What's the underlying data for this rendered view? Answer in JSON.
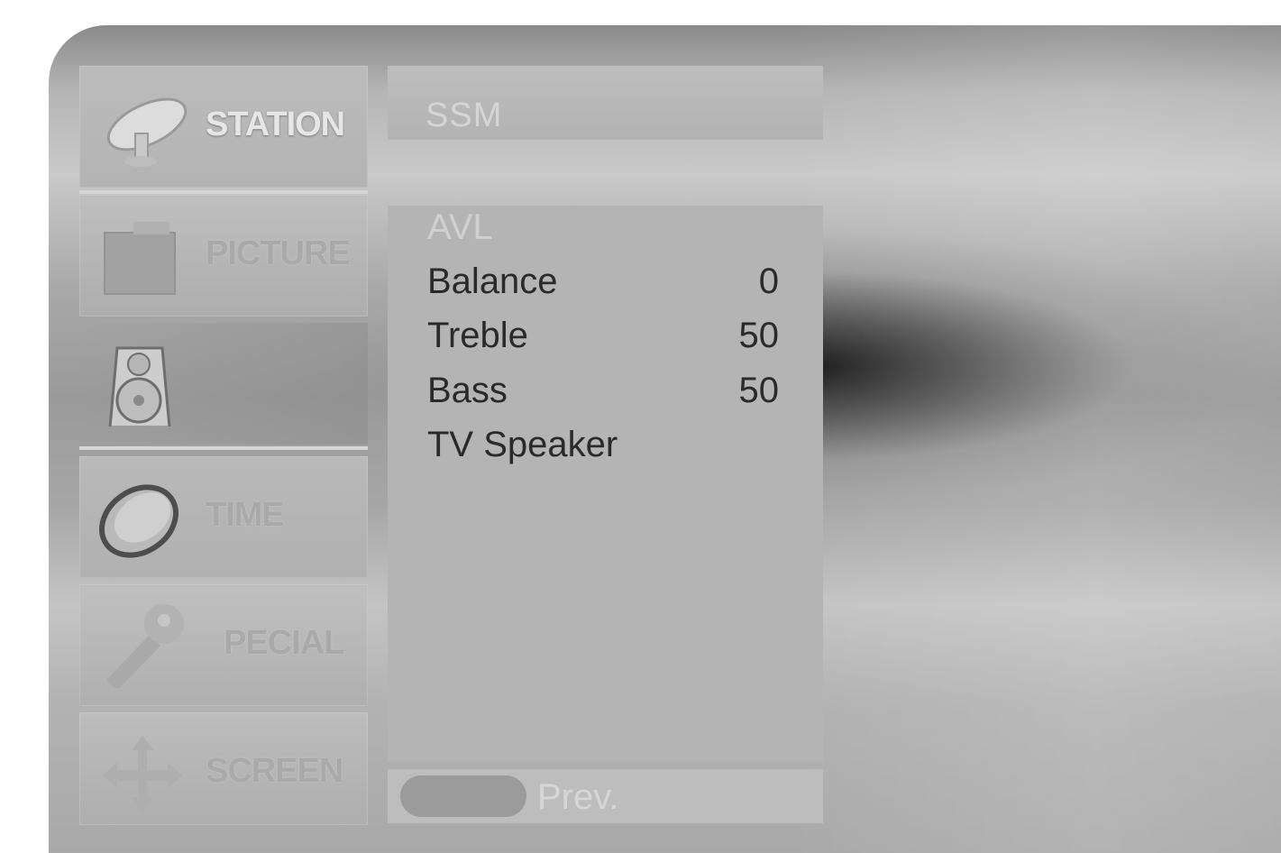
{
  "menu": {
    "categories": [
      {
        "label": "STATION",
        "icon": "satellite-dish-icon"
      },
      {
        "label": "PICTURE",
        "icon": "monitor-icon"
      },
      {
        "label": "",
        "icon": "speaker-icon"
      },
      {
        "label": "TIME",
        "icon": "clock-icon"
      },
      {
        "label": "PECIAL",
        "icon": "key-icon"
      },
      {
        "label": "SCREEN",
        "icon": "arrows-icon"
      }
    ]
  },
  "panel": {
    "header": "SSM",
    "items": [
      {
        "label": "AVL",
        "value": ""
      },
      {
        "label": "Balance",
        "value": "0"
      },
      {
        "label": "Treble",
        "value": "50"
      },
      {
        "label": "Bass",
        "value": "50"
      },
      {
        "label": "TV Speaker",
        "value": ""
      }
    ]
  },
  "nav": {
    "prev_label": "Prev."
  }
}
